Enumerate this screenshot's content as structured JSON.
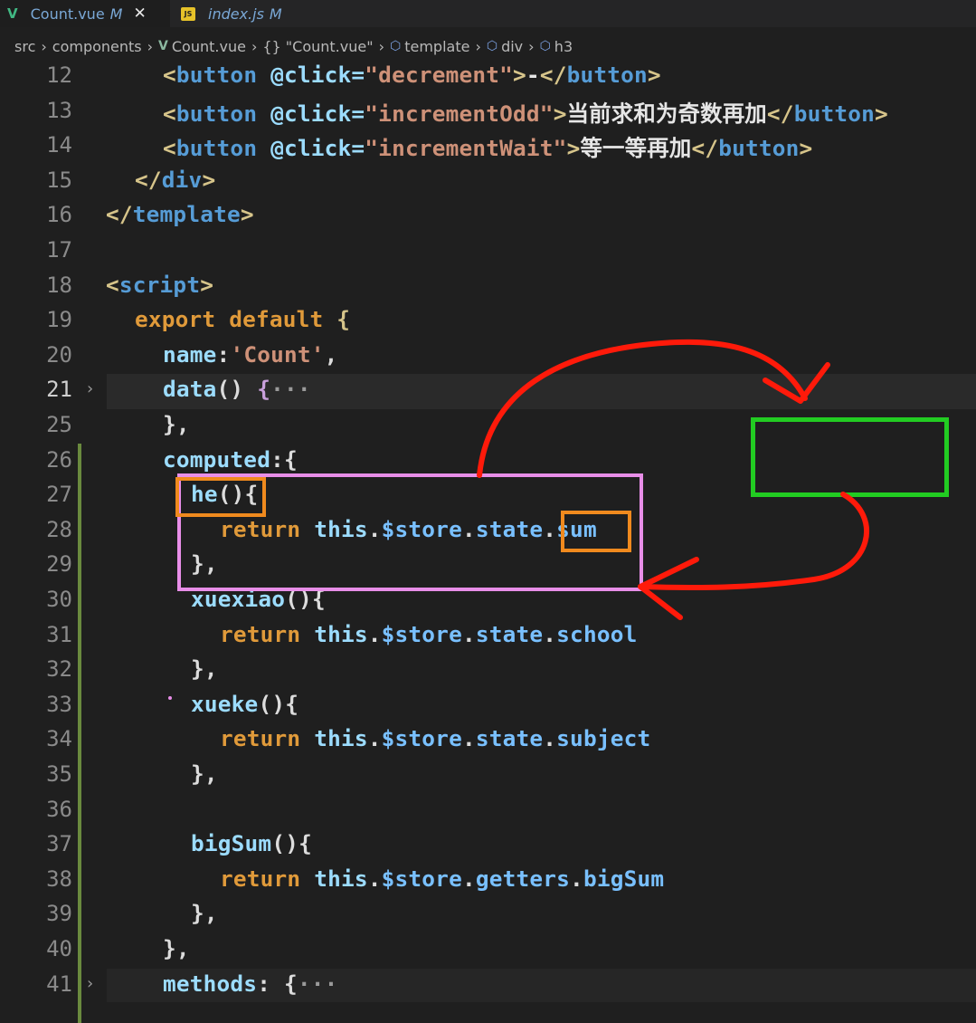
{
  "tabs": [
    {
      "name": "Count.vue",
      "status": "M",
      "icon": "vue-icon",
      "active": true
    },
    {
      "name": "index.js",
      "status": "M",
      "icon": "js-icon",
      "active": false
    }
  ],
  "breadcrumb": [
    "src",
    "components",
    "Count.vue",
    "{} \"Count.vue\"",
    "template",
    "div",
    "h3"
  ],
  "lines": [
    {
      "n": "12"
    },
    {
      "n": "13"
    },
    {
      "n": "14"
    },
    {
      "n": "15"
    },
    {
      "n": "16"
    },
    {
      "n": "17"
    },
    {
      "n": "18"
    },
    {
      "n": "19"
    },
    {
      "n": "20"
    },
    {
      "n": "21"
    },
    {
      "n": "25"
    },
    {
      "n": "26"
    },
    {
      "n": "27"
    },
    {
      "n": "28"
    },
    {
      "n": "29"
    },
    {
      "n": "30"
    },
    {
      "n": "31"
    },
    {
      "n": "32"
    },
    {
      "n": "33"
    },
    {
      "n": "34"
    },
    {
      "n": "35"
    },
    {
      "n": "36"
    },
    {
      "n": "37"
    },
    {
      "n": "38"
    },
    {
      "n": "39"
    },
    {
      "n": "40"
    },
    {
      "n": "41"
    }
  ],
  "code": {
    "l12": {
      "indent": "  ",
      "open": "<",
      "tag": "button",
      "attr": "@click=",
      "val": "\"decrement\"",
      "close": ">",
      "text": "-",
      "endOpen": "</",
      "endTag": "button",
      "endClose": ">"
    },
    "l13": {
      "indent": "  ",
      "open": "<",
      "tag": "button",
      "attr": "@click=",
      "val": "\"incrementOdd\"",
      "close": ">",
      "text": "当前求和为奇数再加",
      "endOpen": "</",
      "endTag": "button",
      "endClose": ">"
    },
    "l14": {
      "indent": "  ",
      "open": "<",
      "tag": "button",
      "attr": "@click=",
      "val": "\"incrementWait\"",
      "close": ">",
      "text": "等一等再加",
      "endOpen": "</",
      "endTag": "button",
      "endClose": ">"
    },
    "l15": {
      "open": "</",
      "tag": "div",
      "close": ">"
    },
    "l16": {
      "open": "</",
      "tag": "template",
      "close": ">"
    },
    "l18": {
      "open": "<",
      "tag": "script",
      "close": ">"
    },
    "l19": {
      "kw1": "export",
      "kw2": "default",
      "brace": "{"
    },
    "l20": {
      "prop": "name",
      "colon": ":",
      "str": "'Count'",
      "comma": ","
    },
    "l21": {
      "fn": "data",
      "paren": "()",
      "brace": "{",
      "ellipsis": "···"
    },
    "l25": {
      "text": "},"
    },
    "l26": {
      "prop": "computed",
      "rest": ":{"
    },
    "l27": {
      "fn": "he",
      "rest": "(){"
    },
    "l28": {
      "kw": "return",
      "this": "this",
      "dot": ".",
      "member1": "$store",
      "member2": "state",
      "member3": "sum"
    },
    "l29": {
      "text": "},"
    },
    "l30": {
      "fn": "xuexiao",
      "rest": "(){"
    },
    "l31": {
      "kw": "return",
      "this": "this",
      "member1": "$store",
      "member2": "state",
      "member3": "school"
    },
    "l32": {
      "text": "},"
    },
    "l33": {
      "fn": "xueke",
      "rest": "(){"
    },
    "l34": {
      "kw": "return",
      "this": "this",
      "member1": "$store",
      "member2": "state",
      "member3": "subject"
    },
    "l35": {
      "text": "},"
    },
    "l37": {
      "fn": "bigSum",
      "rest": "(){"
    },
    "l38": {
      "kw": "return",
      "this": "this",
      "member1": "$store",
      "member2": "getters",
      "member3": "bigSum"
    },
    "l39": {
      "text": "},"
    },
    "l40": {
      "text": "},"
    },
    "l41": {
      "prop": "methods",
      "rest": ": {",
      "ellipsis": "···"
    }
  },
  "annotation_colors": {
    "pink_box": "#e88ee8",
    "orange_box": "#f08a1e",
    "green_box": "#22cc22",
    "red_arrow": "#ff1a0a"
  }
}
